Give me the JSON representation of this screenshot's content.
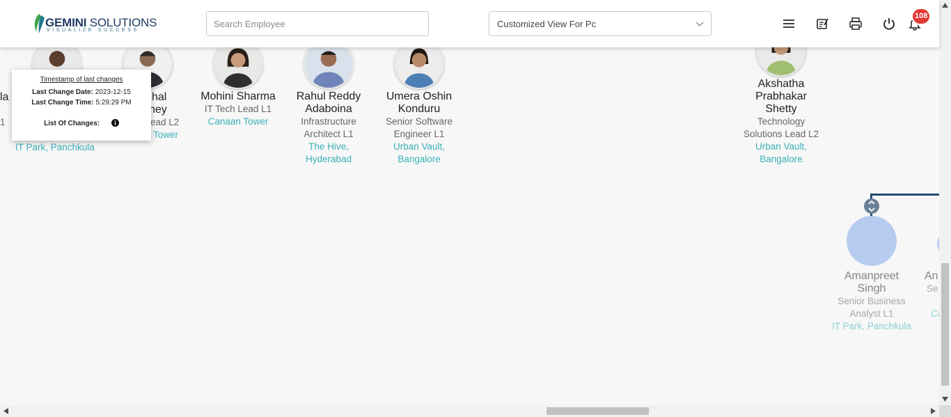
{
  "header": {
    "logo": {
      "brand_bold": "GEMINI",
      "brand_rest": " SOLUTIONS",
      "tagline": "VISUALIZE SUCCESS"
    },
    "search": {
      "placeholder": "Search Employee",
      "value": ""
    },
    "view_select": {
      "selected": "Customized View For Pc"
    },
    "icons": [
      "menu-icon",
      "notes-icon",
      "print-icon",
      "power-icon",
      "bell-icon"
    ],
    "notifications_count": "108"
  },
  "tooltip": {
    "title": "Timestamp of last changes",
    "date_label": "Last Change Date:",
    "date_value": "2023-12-15",
    "time_label": "Last Change Time:",
    "time_value": "5:29:29 PM",
    "changes_label": "List Of Changes:"
  },
  "partial_card": {
    "name_fragment": "la",
    "role_fragment": "1",
    "location": "IT Park, Panchkula"
  },
  "cards": [
    {
      "name": [
        "hal",
        "ney"
      ],
      "role": [
        "ead L2"
      ],
      "location": [
        "Tower"
      ]
    },
    {
      "name": [
        "Mohini Sharma"
      ],
      "role": [
        "IT Tech Lead L1"
      ],
      "location": [
        "Canaan Tower"
      ]
    },
    {
      "name": [
        "Rahul Reddy",
        "Adaboina"
      ],
      "role": [
        "Infrastructure",
        "Architect L1"
      ],
      "location": [
        "The Hive,",
        "Hyderabad"
      ]
    },
    {
      "name": [
        "Umera Oshin",
        "Konduru"
      ],
      "role": [
        "Senior Software",
        "Engineer L1"
      ],
      "location": [
        "Urban Vault,",
        "Bangalore"
      ]
    },
    {
      "name": [
        "Akshatha",
        "Prabhakar",
        "Shetty"
      ],
      "role": [
        "Technology",
        "Solutions Lead L2"
      ],
      "location": [
        "Urban Vault,",
        "Bangalore"
      ]
    },
    {
      "name": [
        "Amanpreet",
        "Singh"
      ],
      "role": [
        "Senior Business",
        "Analyst L1"
      ],
      "location": [
        "IT Park, Panchkula"
      ]
    },
    {
      "name": [
        "An"
      ],
      "role": [
        "Se"
      ],
      "location": [
        "Ca"
      ]
    }
  ],
  "colors": {
    "accent_teal": "#3ab0b8",
    "connector": "#234a6e",
    "badge": "#e53935",
    "brand": "#1f3b63"
  }
}
